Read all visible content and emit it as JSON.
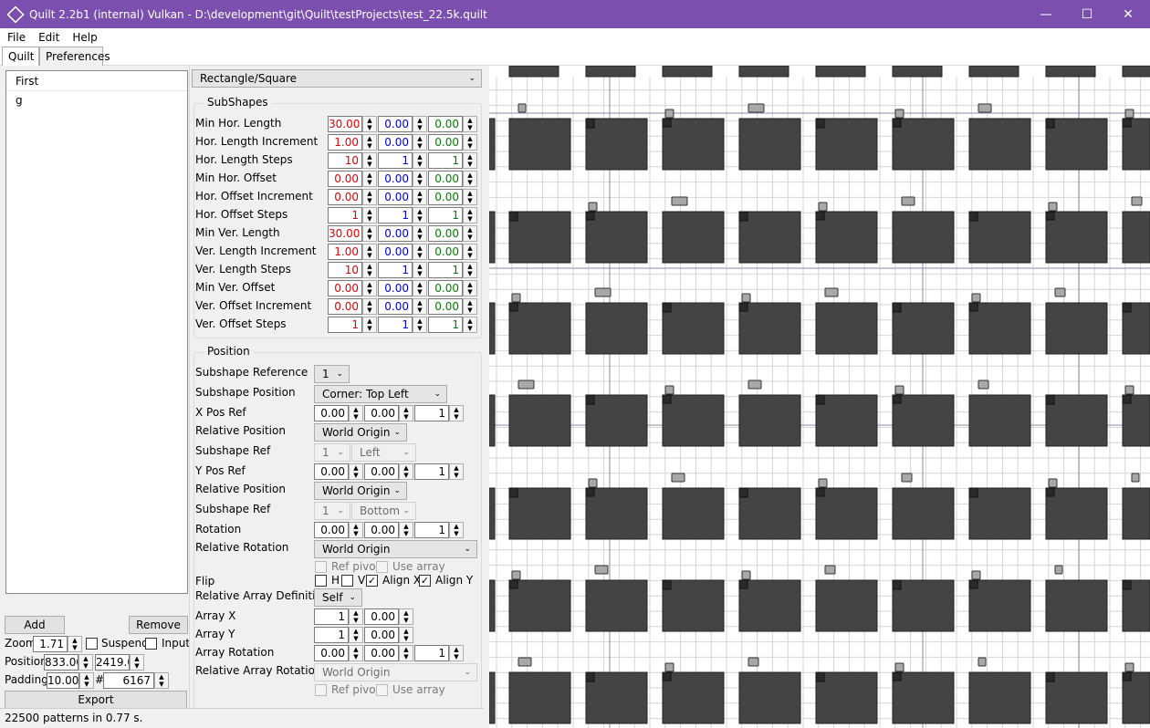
{
  "window": {
    "title": "Quilt 2.2b1 (internal) Vulkan - D:\\development\\git\\Quilt\\testProjects\\test_22.5k.quilt",
    "min_icon": "minimize-icon",
    "max_icon": "maximize-icon",
    "close_icon": "close-icon"
  },
  "menu": [
    "File",
    "Edit",
    "Help"
  ],
  "tabs": [
    "Quilt",
    "Preferences"
  ],
  "layers": {
    "header": "First",
    "items": [
      "g"
    ]
  },
  "left": {
    "add": "Add",
    "remove": "Remove",
    "zoom_label": "Zoom",
    "zoom": "1.71",
    "suspend": "Suspend",
    "input": "Input",
    "position_label": "Position",
    "pos_x": "833.00",
    "pos_y": "2419.0",
    "padding_label": "Padding",
    "padding": "10.00",
    "hash": "#",
    "count": "6167",
    "export": "Export"
  },
  "status": "22500 patterns in 0.77 s.",
  "shape_type": "Rectangle/Square",
  "subshapes": {
    "title": "SubShapes",
    "rows": [
      {
        "label": "Min Hor. Length",
        "v": [
          "30.00",
          "0.00",
          "0.00"
        ]
      },
      {
        "label": "Hor. Length Increment",
        "v": [
          "1.00",
          "0.00",
          "0.00"
        ]
      },
      {
        "label": "Hor. Length Steps",
        "v": [
          "10",
          "1",
          "1"
        ]
      },
      {
        "label": "Min Hor. Offset",
        "v": [
          "0.00",
          "0.00",
          "0.00"
        ]
      },
      {
        "label": "Hor. Offset Increment",
        "v": [
          "0.00",
          "0.00",
          "0.00"
        ]
      },
      {
        "label": "Hor. Offset Steps",
        "v": [
          "1",
          "1",
          "1"
        ]
      },
      {
        "label": "Min Ver. Length",
        "v": [
          "30.00",
          "0.00",
          "0.00"
        ]
      },
      {
        "label": "Ver. Length Increment",
        "v": [
          "1.00",
          "0.00",
          "0.00"
        ]
      },
      {
        "label": "Ver. Length Steps",
        "v": [
          "10",
          "1",
          "1"
        ]
      },
      {
        "label": "Min Ver. Offset",
        "v": [
          "0.00",
          "0.00",
          "0.00"
        ]
      },
      {
        "label": "Ver. Offset Increment",
        "v": [
          "0.00",
          "0.00",
          "0.00"
        ]
      },
      {
        "label": "Ver. Offset Steps",
        "v": [
          "1",
          "1",
          "1"
        ]
      }
    ]
  },
  "position": {
    "title": "Position",
    "subshape_reference_label": "Subshape Reference",
    "subshape_reference": "1",
    "subshape_position_label": "Subshape Position",
    "subshape_position": "Corner: Top Left",
    "xpos_label": "X Pos Ref",
    "xpos": [
      "0.00",
      "0.00",
      "1"
    ],
    "rel_pos_label": "Relative Position",
    "rel_pos_x": "World Origin",
    "subshape_ref_label": "Subshape Ref",
    "sub_ref_x": "1",
    "sub_ref_x_side": "Left",
    "ypos_label": "Y Pos Ref",
    "ypos": [
      "0.00",
      "0.00",
      "1"
    ],
    "rel_pos_y": "World Origin",
    "sub_ref_y": "1",
    "sub_ref_y_side": "Bottom",
    "rotation_label": "Rotation",
    "rotation": [
      "0.00",
      "0.00",
      "1"
    ],
    "rel_rot_label": "Relative Rotation",
    "rel_rot": "World Origin",
    "ref_pivot": "Ref pivot",
    "use_array": "Use array",
    "flip_label": "Flip",
    "flip_h": "H",
    "flip_v": "V",
    "align_x": "Align X",
    "align_y": "Align Y",
    "rel_array_def_label": "Relative Array Definition",
    "rel_array_def": "Self",
    "array_x_label": "Array X",
    "array_x": [
      "1",
      "0.00"
    ],
    "array_y_label": "Array Y",
    "array_y": [
      "1",
      "0.00"
    ],
    "array_rot_label": "Array Rotation",
    "array_rot": [
      "0.00",
      "0.00",
      "1"
    ],
    "rel_array_rot_label": "Relative Array Rotation",
    "rel_array_rot": "World Origin",
    "ref_pivot2": "Ref pivot",
    "use_array2": "Use array"
  },
  "colors": {
    "title_bar": "#7a4fae",
    "shape_fill": "#444444",
    "marker_fill": "#a8a8a8",
    "grid": "#d4d4d4",
    "red": "#e00000",
    "blue": "#0000c8",
    "green": "#008000"
  }
}
